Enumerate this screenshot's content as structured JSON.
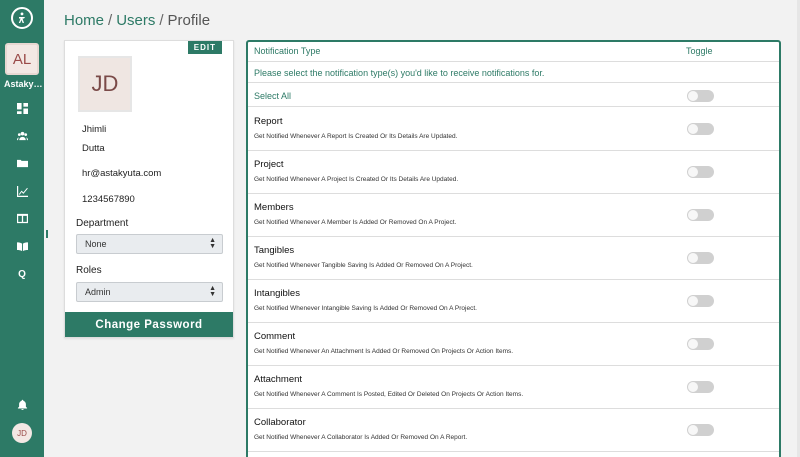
{
  "sidebar": {
    "org_initials": "AL",
    "org_name": "Astakyuta",
    "user_initials": "JD",
    "nav_icons": [
      "dashboard-icon",
      "users-icon",
      "folder-icon",
      "chart-icon",
      "board-icon",
      "book-icon",
      "q-icon"
    ],
    "q_glyph": "Q",
    "bell_icon": "bell-icon",
    "accent_color": "#2d7a66"
  },
  "breadcrumb": {
    "items": [
      "Home",
      "Users",
      "Profile"
    ],
    "separator": "/"
  },
  "profile": {
    "edit_label": "EDIT",
    "avatar_initials": "JD",
    "first_name": "Jhimli",
    "last_name": "Dutta",
    "email": "hr@astakyuta.com",
    "phone": "1234567890",
    "department_label": "Department",
    "department_value": "None",
    "roles_label": "Roles",
    "roles_value": "Admin",
    "change_password_label": "Change Password"
  },
  "notifications": {
    "header_type": "Notification Type",
    "header_toggle": "Toggle",
    "intro": "Please select the notification type(s) you'd like to receive notifications for.",
    "select_all_label": "Select All",
    "select_all_on": false,
    "items": [
      {
        "title": "Report",
        "description": "Get Notified Whenever A Report Is Created Or Its Details Are Updated.",
        "enabled": false
      },
      {
        "title": "Project",
        "description": "Get Notified Whenever A Project Is Created Or Its Details Are Updated.",
        "enabled": false
      },
      {
        "title": "Members",
        "description": "Get Notified Whenever A Member Is Added Or Removed On A Project.",
        "enabled": false
      },
      {
        "title": "Tangibles",
        "description": "Get Notified Whenever Tangible Saving Is Added Or Removed On A Project.",
        "enabled": false
      },
      {
        "title": "Intangibles",
        "description": "Get Notified Whenever Intangible Saving Is Added Or Removed On A Project.",
        "enabled": false
      },
      {
        "title": "Comment",
        "description": "Get Notified Whenever An Attachment Is Added Or Removed On Projects Or Action Items.",
        "enabled": false
      },
      {
        "title": "Attachment",
        "description": "Get Notified Whenever A Comment Is Posted, Edited Or Deleted On Projects Or Action Items.",
        "enabled": false
      },
      {
        "title": "Collaborator",
        "description": "Get Notified Whenever A Collaborator Is Added Or Removed On A Report.",
        "enabled": false
      }
    ]
  }
}
